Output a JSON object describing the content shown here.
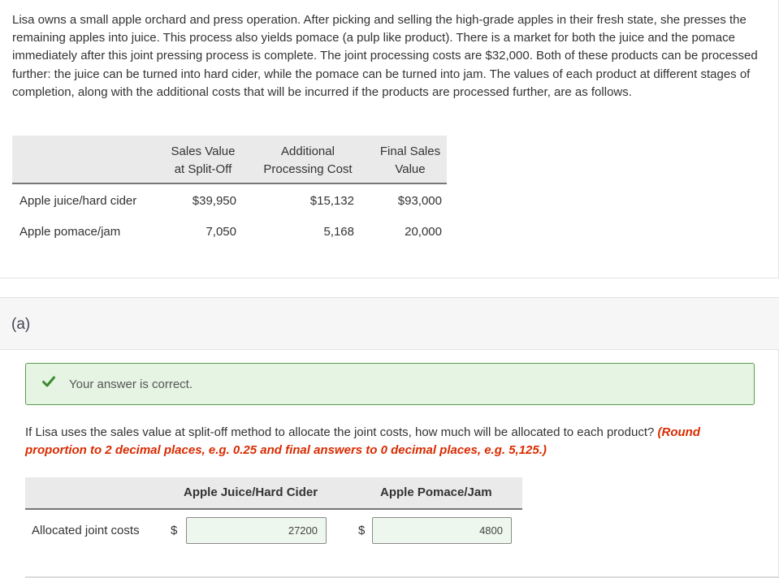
{
  "intro": {
    "text": "Lisa owns a small apple orchard and press operation. After picking and selling the high-grade apples in their fresh state, she presses the remaining apples into juice. This process also yields pomace (a pulp like product). There is a market for both the juice and the pomace immediately after this joint pressing process is complete. The joint processing costs are $32,000. Both of these products can be processed further: the juice can be turned into hard cider, while the pomace can be turned into jam. The values of each product at different stages of completion, along with the additional costs that will be incurred if the products are processed further, are as follows."
  },
  "table1": {
    "headers": {
      "sales_value_1": "Sales Value",
      "sales_value_2": "at Split-Off",
      "additional_1": "Additional",
      "additional_2": "Processing Cost",
      "final_1": "Final Sales",
      "final_2": "Value"
    },
    "rows": [
      {
        "label": "Apple juice/hard cider",
        "split_off": "$39,950",
        "additional": "$15,132",
        "final": "$93,000"
      },
      {
        "label": "Apple pomace/jam",
        "split_off": "7,050",
        "additional": "5,168",
        "final": "20,000"
      }
    ]
  },
  "part_a": {
    "label": "(a)",
    "status": "Your answer is correct.",
    "question": "If Lisa uses the sales value at split-off method to allocate the joint costs, how much will be allocated to each product?",
    "hint": "(Round proportion to 2 decimal places, e.g. 0.25 and final answers to 0 decimal places, e.g. 5,125.)"
  },
  "table2": {
    "col1": "Apple Juice/Hard Cider",
    "col2": "Apple Pomace/Jam",
    "row_label": "Allocated joint costs",
    "currency": "$",
    "answer1": "27200",
    "answer2": "4800"
  },
  "colors": {
    "correct_bg": "#e6f4e3",
    "correct_border": "#5a9a4e",
    "check_green": "#3a8a2e",
    "hint_red": "#d92b00"
  }
}
